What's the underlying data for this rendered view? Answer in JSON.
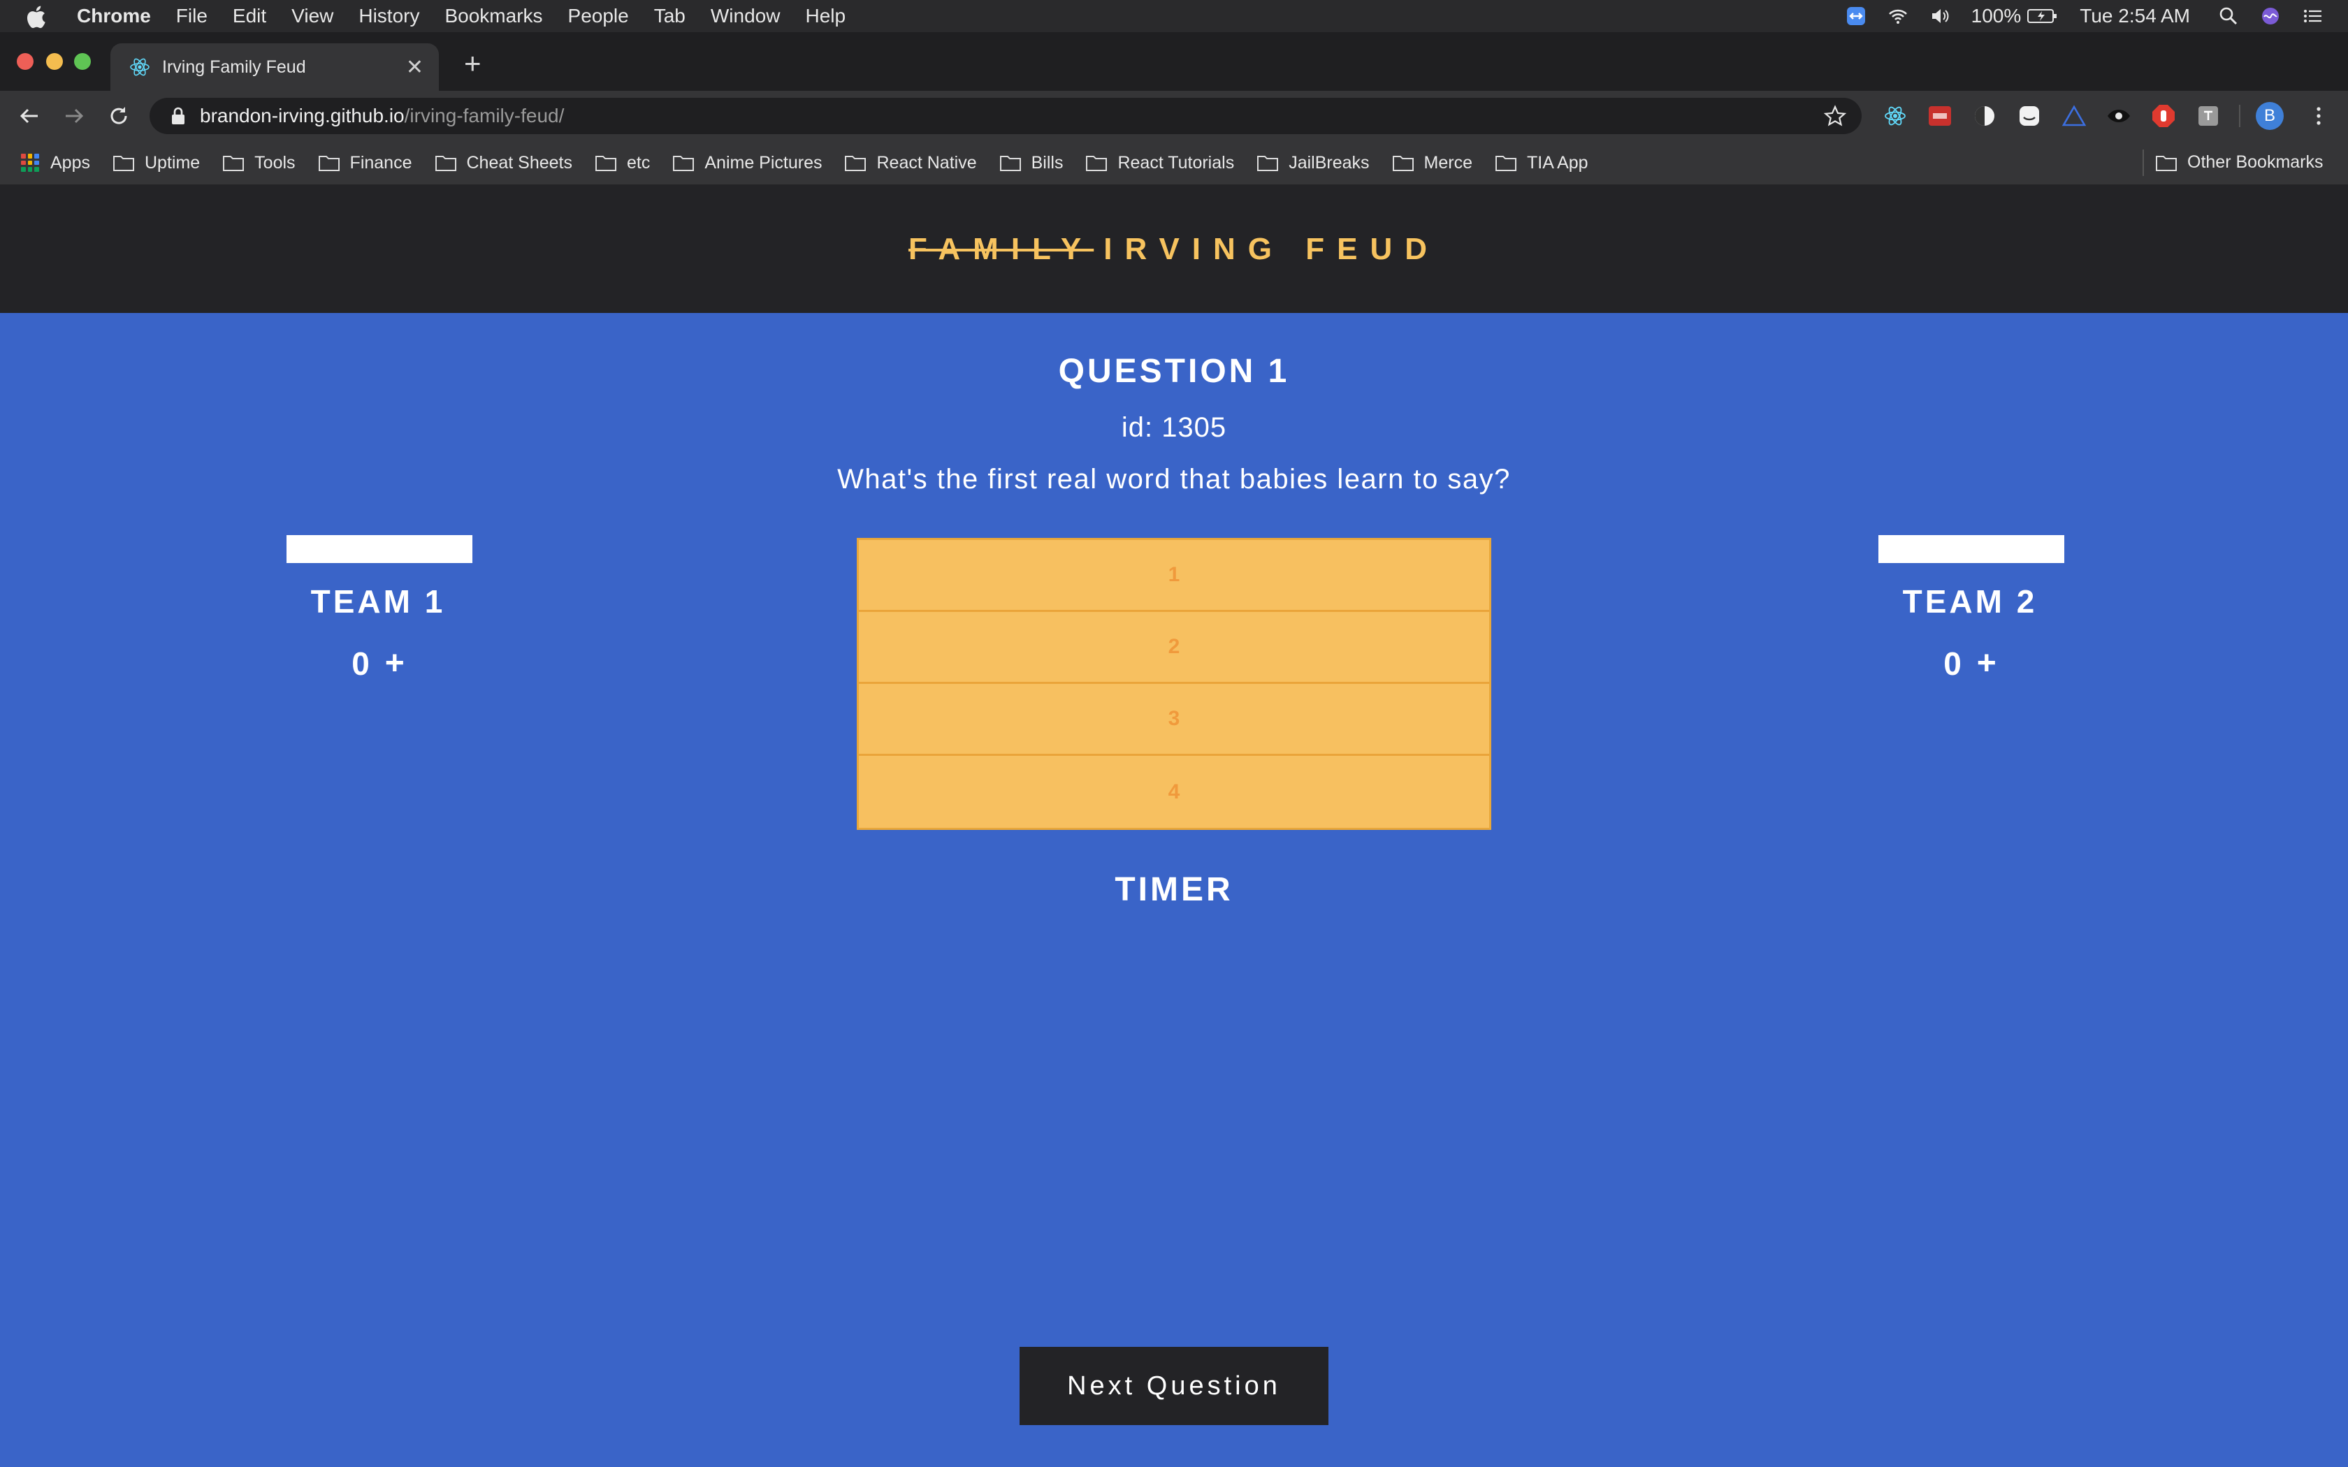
{
  "menubar": {
    "app_name": "Chrome",
    "items": [
      "File",
      "Edit",
      "View",
      "History",
      "Bookmarks",
      "People",
      "Tab",
      "Window",
      "Help"
    ],
    "battery": "100%",
    "clock": "Tue 2:54 AM"
  },
  "browser": {
    "tab_title": "Irving Family Feud",
    "tab_close": "✕",
    "new_tab": "+",
    "url_host": "brandon-irving.github.io",
    "url_path": "/irving-family-feud/",
    "profile_initial": "B"
  },
  "bookmarks": {
    "apps_label": "Apps",
    "folders": [
      "Uptime",
      "Tools",
      "Finance",
      "Cheat Sheets",
      "etc",
      "Anime Pictures",
      "React Native",
      "Bills",
      "React Tutorials",
      "JailBreaks",
      "Merce",
      "TIA App"
    ],
    "other_label": "Other Bookmarks"
  },
  "site": {
    "title_struck": "FAMILY",
    "title_rest": "IRVING FEUD"
  },
  "question": {
    "heading": "QUESTION 1",
    "id_text": "id: 1305",
    "text": "What's the first real word that babies learn to say?"
  },
  "teams": [
    {
      "name": "TEAM 1",
      "score": "0",
      "plus": "+",
      "input_value": ""
    },
    {
      "name": "TEAM 2",
      "score": "0",
      "plus": "+",
      "input_value": ""
    }
  ],
  "board": {
    "slots": [
      "1",
      "2",
      "3",
      "4"
    ]
  },
  "timer_label": "TIMER",
  "next_button": "Next Question",
  "colors": {
    "page_background": "#3a64c8",
    "header_background": "#232326",
    "title_accent": "#f7c35f",
    "board_fill": "#f7c060",
    "board_number": "#f09a3c"
  }
}
